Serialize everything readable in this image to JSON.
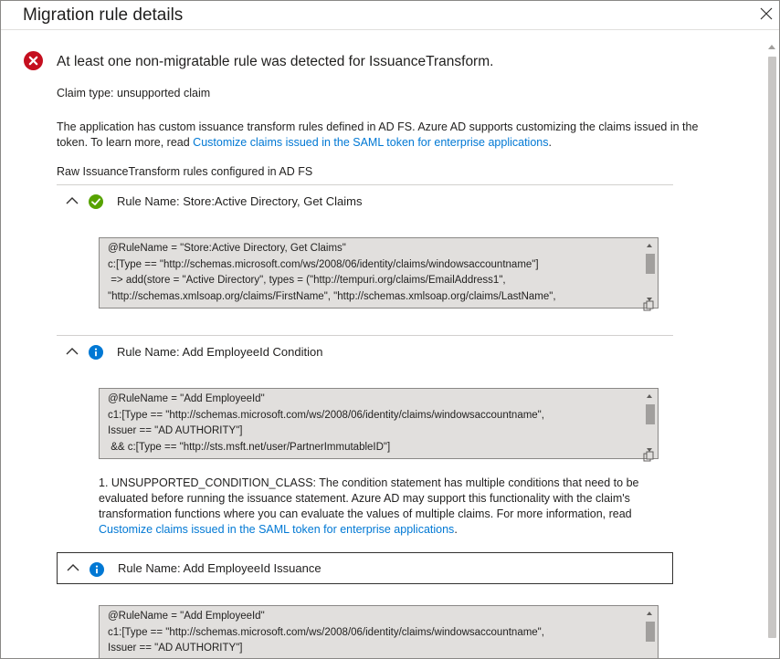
{
  "panel": {
    "title": "Migration rule details",
    "close_icon": "close-icon"
  },
  "error": {
    "icon": "error-circle-icon",
    "message": "At least one non-migratable rule was detected for IssuanceTransform."
  },
  "claim_type": "Claim type: unsupported claim",
  "description": {
    "text": "The application has custom issuance transform rules defined in AD FS. Azure AD supports customizing the claims issued in the token. To learn more, read ",
    "link": "Customize claims issued in the SAML token for enterprise applications",
    "suffix": "."
  },
  "raw_title": "Raw IssuanceTransform rules configured in AD FS",
  "rules": [
    {
      "status_icon": "check-circle-icon",
      "name": "Rule Name: Store:Active Directory, Get Claims",
      "code": "@RuleName = \"Store:Active Directory, Get Claims\"\nc:[Type == \"http://schemas.microsoft.com/ws/2008/06/identity/claims/windowsaccountname\"]\n => add(store = \"Active Directory\", types = (\"http://tempuri.org/claims/EmailAddress1\",\n\"http://schemas.xmlsoap.org/claims/FirstName\", \"http://schemas.xmlsoap.org/claims/LastName\","
    },
    {
      "status_icon": "info-circle-icon",
      "name": "Rule Name: Add EmployeeId Condition",
      "code": "@RuleName = \"Add EmployeeId\"\nc1:[Type == \"http://schemas.microsoft.com/ws/2008/06/identity/claims/windowsaccountname\",\nIssuer == \"AD AUTHORITY\"]\n && c:[Type == \"http://sts.msft.net/user/PartnerImmutableID\"]",
      "note": {
        "text": "1. UNSUPPORTED_CONDITION_CLASS: The condition statement has multiple conditions that need to be evaluated before running the issuance statement. Azure AD may support this functionality with the claim's transformation functions where you can evaluate the values of multiple claims. For more information, read ",
        "link": "Customize claims issued in the SAML token for enterprise applications",
        "suffix": "."
      }
    },
    {
      "status_icon": "info-circle-icon",
      "name": "Rule Name: Add EmployeeId Issuance",
      "code": "@RuleName = \"Add EmployeeId\"\nc1:[Type == \"http://schemas.microsoft.com/ws/2008/06/identity/claims/windowsaccountname\",\nIssuer == \"AD AUTHORITY\"]"
    }
  ],
  "colors": {
    "link": "#0078d4",
    "error": "#c50f1f",
    "success": "#57a300",
    "info": "#0078d4"
  }
}
